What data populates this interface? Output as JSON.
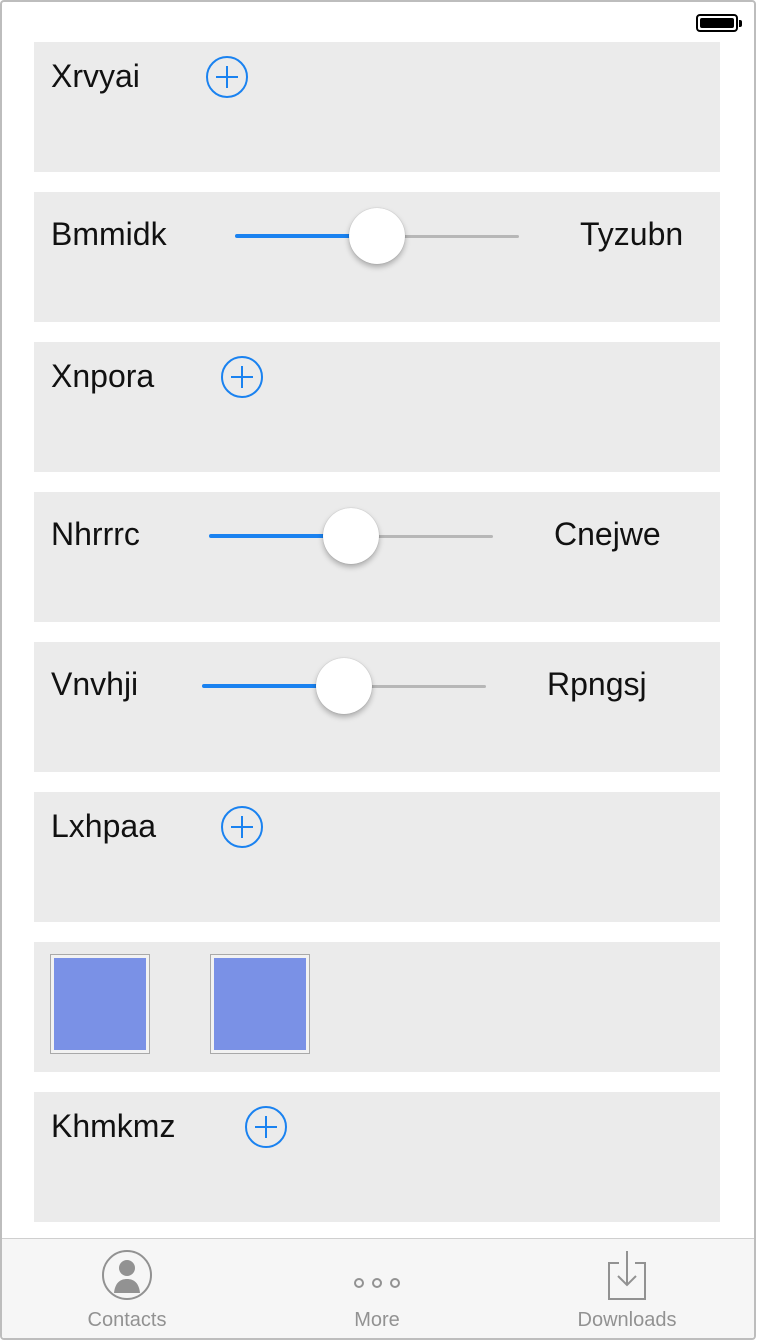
{
  "accent_color": "#1a82f0",
  "swatch_color": "#7a91e6",
  "rows": [
    {
      "type": "add",
      "label": "Xrvyai"
    },
    {
      "type": "slider",
      "label": "Bmmidk",
      "right_label": "Tyzubn",
      "value_fraction": 0.5
    },
    {
      "type": "add",
      "label": "Xnpora"
    },
    {
      "type": "slider",
      "label": "Nhrrrc",
      "right_label": "Cnejwe",
      "value_fraction": 0.5
    },
    {
      "type": "slider",
      "label": "Vnvhji",
      "right_label": "Rpngsj",
      "value_fraction": 0.5
    },
    {
      "type": "add",
      "label": "Lxhpaa"
    },
    {
      "type": "swatches",
      "count": 2
    },
    {
      "type": "add",
      "label": "Khmkmz"
    }
  ],
  "tab_bar": {
    "tabs": [
      {
        "label": "Contacts",
        "icon": "contacts-icon"
      },
      {
        "label": "More",
        "icon": "more-icon"
      },
      {
        "label": "Downloads",
        "icon": "downloads-icon"
      }
    ]
  }
}
